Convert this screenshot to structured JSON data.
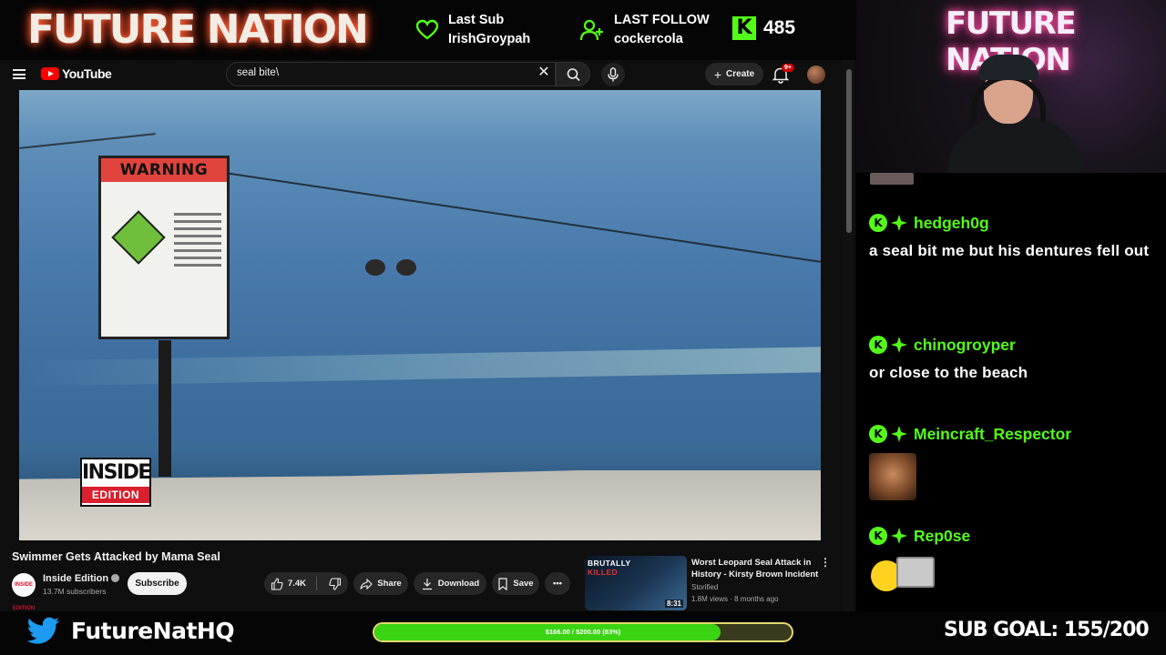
{
  "overlay": {
    "brand": "FUTURE NATION",
    "last_sub_label": "Last Sub",
    "last_sub_name": "IrishGroypah",
    "last_follow_label": "LAST FOLLOW",
    "last_follow_name": "cockercola",
    "kick_followers": "485",
    "twitter_handle": "FutureNatHQ",
    "sub_goal": "SUB GOAL: 155/200",
    "progress_label": "$166.00 / $200.00 (83%)",
    "progress_fraction": 0.83,
    "colors": {
      "kick_green": "#53fc18",
      "progress_green": "#3bd412"
    }
  },
  "youtube": {
    "logo_text": "YouTube",
    "search_value": "seal bite\\",
    "create_label": "Create",
    "notification_badge": "9+",
    "video": {
      "title": "Swimmer Gets Attacked by Mama Seal",
      "sign_header": "WARNING",
      "watermark_line1": "INSIDE",
      "watermark_line2": "EDITION"
    },
    "channel": {
      "name": "Inside Edition",
      "subscribers": "13.7M subscribers",
      "avatar_text": "INSIDE EDITION"
    },
    "actions": {
      "subscribe": "Subscribe",
      "likes": "7.4K",
      "share": "Share",
      "download": "Download",
      "save": "Save"
    },
    "suggested": {
      "title": "Worst Leopard Seal Attack in History - Kirsty Brown Incident",
      "channel": "Storified",
      "meta": "1.8M views · 8 months ago",
      "duration": "8:31",
      "thumb_line1": "BRUTALLY",
      "thumb_line2": "KILLED"
    }
  },
  "webcam": {
    "neon_text": "FUTURE NATION"
  },
  "chat": {
    "messages": [
      {
        "user": "hedgeh0g",
        "text": "a seal bit me but his dentures fell out"
      },
      {
        "user": "chinogroyper",
        "text": "or close to the beach"
      },
      {
        "user": "Meincraft_Respector",
        "text": ""
      },
      {
        "user": "Rep0se",
        "text": ""
      }
    ]
  }
}
